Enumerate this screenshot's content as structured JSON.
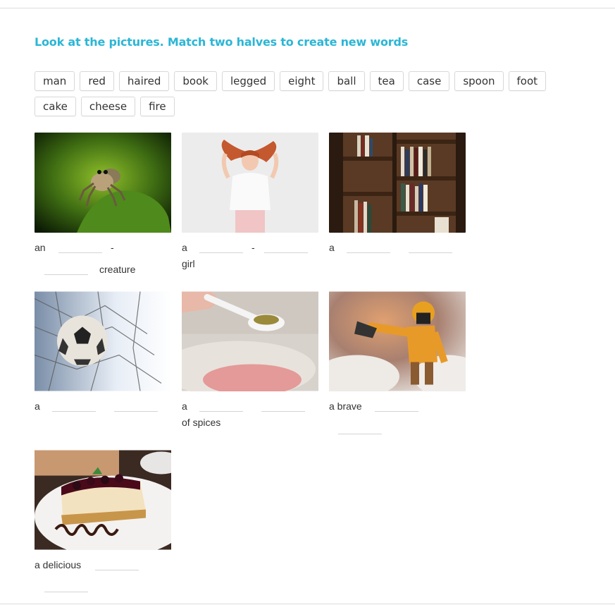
{
  "title": "Look at the pictures. Match two halves to create new words",
  "chips": [
    "man",
    "red",
    "haired",
    "book",
    "legged",
    "eight",
    "ball",
    "tea",
    "case",
    "spoon",
    "foot",
    "cake",
    "cheese",
    "fire"
  ],
  "cards": [
    {
      "image": "spider",
      "prefix": "an",
      "dash": "-",
      "suffix": "creature"
    },
    {
      "image": "red-haired-girl",
      "prefix": "a",
      "dash": "-",
      "suffix": "girl"
    },
    {
      "image": "bookcase",
      "prefix": "a"
    },
    {
      "image": "football",
      "prefix": "a"
    },
    {
      "image": "teaspoon",
      "prefix": "a",
      "suffix": "of spices"
    },
    {
      "image": "fireman",
      "prefix": "a brave"
    },
    {
      "image": "cheesecake",
      "prefix": "a delicious"
    }
  ]
}
